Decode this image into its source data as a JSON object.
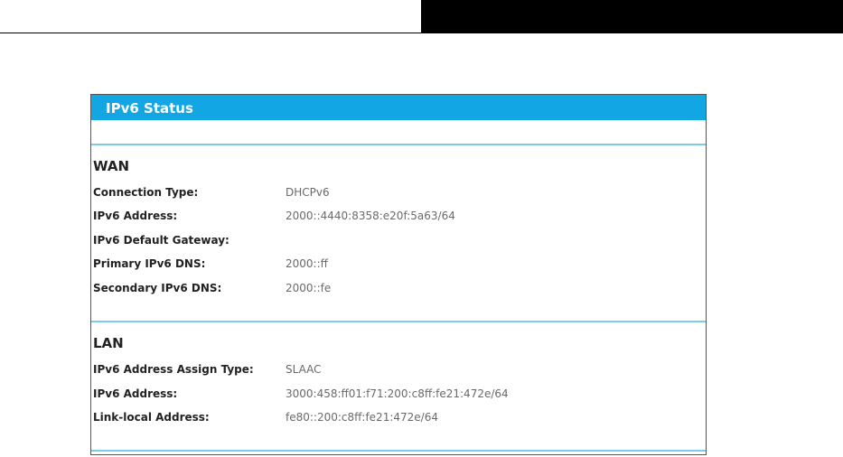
{
  "panel": {
    "title": "IPv6 Status"
  },
  "wan": {
    "title": "WAN",
    "rows": [
      {
        "label": "Connection Type:",
        "value": "DHCPv6"
      },
      {
        "label": "IPv6 Address:",
        "value": "2000::4440:8358:e20f:5a63/64"
      },
      {
        "label": "IPv6 Default Gateway:",
        "value": ""
      },
      {
        "label": "Primary IPv6 DNS:",
        "value": "2000::ff"
      },
      {
        "label": "Secondary IPv6 DNS:",
        "value": "2000::fe"
      }
    ]
  },
  "lan": {
    "title": "LAN",
    "rows": [
      {
        "label": "IPv6 Address Assign Type:",
        "value": "SLAAC"
      },
      {
        "label": "IPv6 Address:",
        "value": "3000:458:ff01:f71:200:c8ff:fe21:472e/64"
      },
      {
        "label": "Link-local Address:",
        "value": "fe80::200:c8ff:fe21:472e/64"
      }
    ]
  },
  "colors": {
    "header": "#12a7e3",
    "rule": "#7ccbe9"
  }
}
